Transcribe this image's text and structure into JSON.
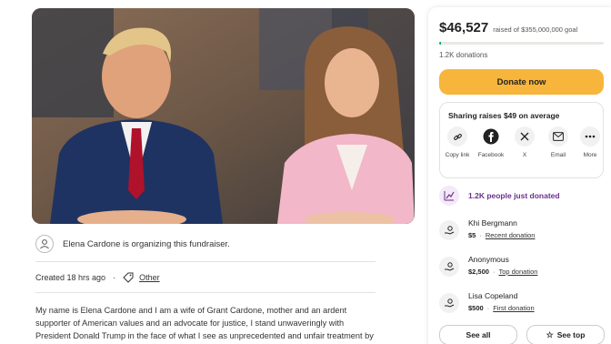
{
  "organizer": {
    "text": "Elena Cardone is organizing this fundraiser."
  },
  "meta": {
    "created": "Created 18 hrs ago",
    "category": "Other"
  },
  "story": {
    "lines": [
      "My name is Elena Cardone and I am a wife of Grant Cardone, mother and an ardent",
      "supporter of American values and an advocate for justice, I stand unwaveringly with",
      "President Donald Trump in the face of what I see as unprecedented and unfair treatment by"
    ]
  },
  "progress": {
    "raised": "$46,527",
    "goal": "raised of $355,000,000 goal",
    "fraction": 0.0131,
    "donations": "1.2K donations"
  },
  "donate": {
    "label": "Donate now"
  },
  "share": {
    "title": "Sharing raises $49 on average",
    "items": [
      {
        "label": "Copy link",
        "icon": "link-icon"
      },
      {
        "label": "Facebook",
        "icon": "facebook-icon"
      },
      {
        "label": "X",
        "icon": "x-icon"
      },
      {
        "label": "Email",
        "icon": "email-icon"
      },
      {
        "label": "More",
        "icon": "more-icon"
      }
    ]
  },
  "recent": {
    "text": "1.2K people just donated"
  },
  "donors": [
    {
      "name": "Khi Bergmann",
      "amount": "$5",
      "note": "Recent donation"
    },
    {
      "name": "Anonymous",
      "amount": "$2,500",
      "note": "Top donation"
    },
    {
      "name": "Lisa Copeland",
      "amount": "$500",
      "note": "First donation"
    }
  ],
  "buttons": {
    "see_all": "See all",
    "see_top": "See top"
  },
  "colors": {
    "accent_yellow": "#f7b53b",
    "progress_green": "#02a95c",
    "purple": "#6b2f8a"
  }
}
